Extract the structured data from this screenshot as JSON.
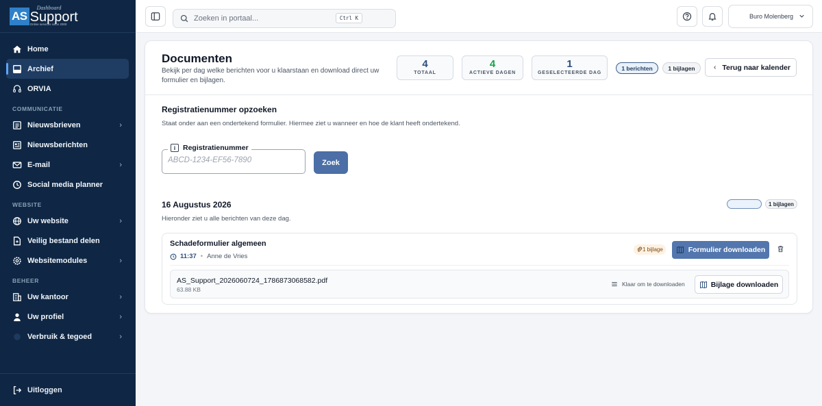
{
  "logo": {
    "prefix": "AS",
    "top": "Dashboard",
    "main": "Support",
    "tagline": "Online services since 2000"
  },
  "sidebar": {
    "items": [
      {
        "label": "Home"
      },
      {
        "label": "Archief"
      },
      {
        "label": "ORVIA"
      }
    ],
    "sections": {
      "communicatie": "COMMUNICATIE",
      "website": "WEBSITE",
      "beheer": "BEHEER"
    },
    "communicatie_items": [
      {
        "label": "Nieuwsbrieven"
      },
      {
        "label": "Nieuwsberichten"
      },
      {
        "label": "E-mail"
      },
      {
        "label": "Social media planner"
      }
    ],
    "website_items": [
      {
        "label": "Uw website"
      },
      {
        "label": "Veilig bestand delen"
      },
      {
        "label": "Websitemodules"
      }
    ],
    "beheer_items": [
      {
        "label": "Uw kantoor"
      },
      {
        "label": "Uw profiel"
      },
      {
        "label": "Verbruik & tegoed"
      }
    ],
    "logout": "Uitloggen"
  },
  "topbar": {
    "search_placeholder": "Zoeken in portaal...",
    "shortcut": "Ctrl K",
    "user": "Buro Molenberg"
  },
  "header": {
    "title": "Documenten",
    "description": "Bekijk per dag welke berichten voor u klaarstaan en download direct uw formulier en bijlagen.",
    "stats": [
      {
        "value": "4",
        "label": "TOTAAL",
        "color": "#2d4f7c"
      },
      {
        "value": "4",
        "label": "ACTIEVE DAGEN",
        "color": "#16a34a"
      },
      {
        "value": "1",
        "label": "GESELECTEERDE DAG",
        "color": "#2d4f7c"
      }
    ],
    "pill_berichten": "1 berichten",
    "pill_bijlagen": "1 bijlagen",
    "back_button": "Terug naar kalender"
  },
  "lookup": {
    "title": "Registratienummer opzoeken",
    "subtitle": "Staat onder aan een ondertekend formulier. Hiermee ziet u wanneer en hoe de klant heeft ondertekend.",
    "field_label": "Registratienummer",
    "placeholder": "ABCD-1234-EF56-7890",
    "value": "",
    "button": "Zoek"
  },
  "day": {
    "title": "16 Augustus 2026",
    "subtitle": "Hieronder ziet u alle berichten van deze dag.",
    "pill_bijlagen": "1 bijlagen"
  },
  "message": {
    "title": "Schadeformulier algemeen",
    "time": "11:37",
    "sender": "Anne de Vries",
    "attachment_pill": "1 bijlage",
    "download_button": "Formulier downloaden",
    "file": {
      "name": "AS_Support_2026060724_1786873068582.pdf",
      "size": "63.88 KB",
      "status": "Klaar om te downloaden",
      "button": "Bijlage downloaden"
    }
  },
  "colors": {
    "sidebar": "#0f2744",
    "accent": "#5276ad",
    "active_green": "#16a34a"
  }
}
